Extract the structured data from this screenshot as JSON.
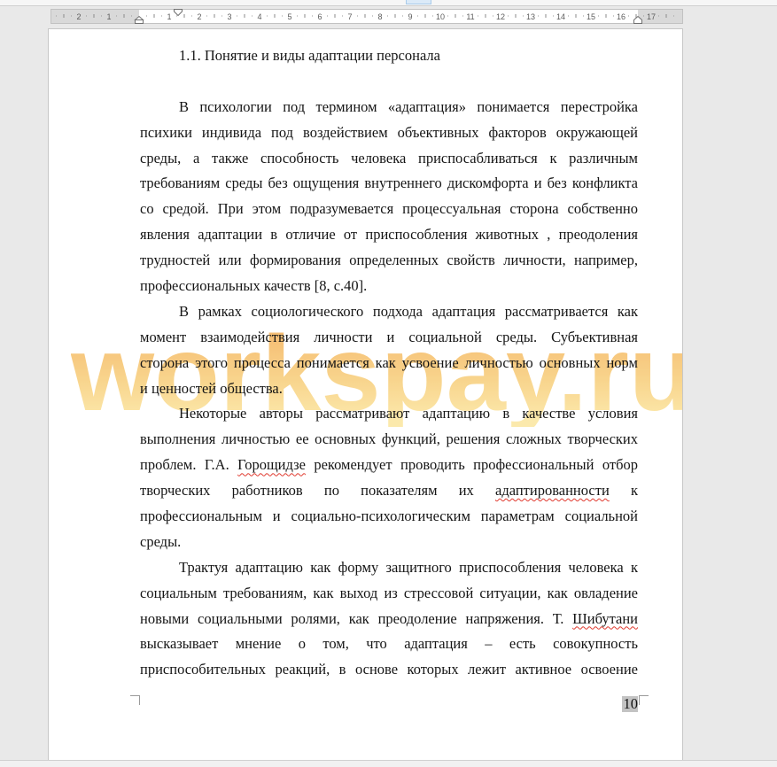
{
  "ruler": {
    "left_margin_labels": [
      "2",
      "1"
    ],
    "body_labels": [
      "1",
      "2",
      "3",
      "4",
      "5",
      "6",
      "7",
      "8",
      "9",
      "10",
      "11",
      "12",
      "13",
      "14",
      "15",
      "16"
    ],
    "right_margin_labels": [
      "17"
    ]
  },
  "document": {
    "heading": "1.1. Понятие и виды адаптации  персонала",
    "paragraphs": [
      {
        "lines": [
          "В психологии под термином «адаптация» понимается перестройка",
          "психики индивида под воздействием объективных факторов окружающей",
          "среды, а также способность человека приспосабливаться к различным",
          "требованиям среды без ощущения внутреннего дискомфорта и без конфликта",
          "со средой. При этом подразумевается процессуальная сторона собственно",
          "явления адаптации в отличие от приспособления животных , преодоления",
          "трудностей  или формирования определенных свойств личности, например,",
          "профессиональных качеств [8, с.40]."
        ]
      },
      {
        "lines": [
          "В рамках социологического подхода адаптация рассматривается как",
          "момент взаимодействия личности и социальной среды. Субъективная",
          "сторона этого процесса понимается как усвоение личностью основных норм",
          "и ценностей общества."
        ]
      },
      {
        "lines": [
          "Некоторые авторы рассматривают адаптацию в качестве условия",
          "выполнения личностью ее основных функций, решения сложных творческих",
          {
            "before": "проблем. Г.А. ",
            "flagged": "Горощидзе",
            "after": "  рекомендует проводить профессиональный отбор"
          },
          {
            "before": "творческих работников по показателям их ",
            "flagged": "адаптированности",
            "after": " к"
          },
          "профессиональным и социально-психологическим параметрам социальной",
          "среды."
        ]
      },
      {
        "lines": [
          "Трактуя адаптацию как форму защитного приспособления человека к",
          "социальным требованиям, как выход из стрессовой ситуации, как овладение",
          {
            "before": "новыми социальными ролями, как преодоление напряжения. Т. ",
            "flagged": "Шибутани"
          },
          "высказывает мнение о том, что адаптация – есть совокупность",
          "приспособительных реакций, в основе которых лежит активное освоение"
        ]
      }
    ],
    "watermark": "workspay.ru",
    "page_number": "10"
  },
  "colors": {
    "watermark_top": "#f3ad4e",
    "watermark_mid": "#f7c86c",
    "watermark_bottom": "#fbe496",
    "spellcheck_underline": "#e03a2f",
    "page_number_shading": "#c3c3c3"
  }
}
